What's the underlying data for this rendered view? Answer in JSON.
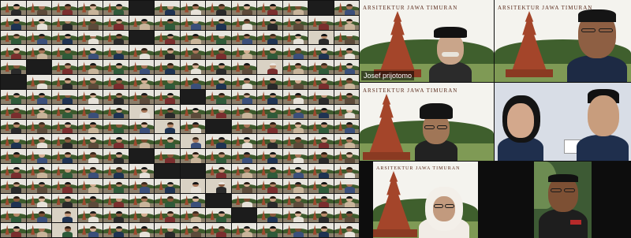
{
  "window": {
    "view_mode": "gallery"
  },
  "gallery": {
    "columns": 14,
    "rows": 16,
    "blank_cells": [
      5,
      12,
      33,
      57,
      70,
      91,
      120,
      145,
      160,
      161,
      190,
      205
    ],
    "room_cells": [
      40,
      66,
      103,
      118,
      133,
      175,
      176,
      198,
      212
    ]
  },
  "speakers": [
    {
      "id": "tile-1",
      "banner": "ARSITEKTUR JAWA TIMURAN",
      "name": "Josef prijotomo",
      "skin": "#c9a58a",
      "shirt": "#2b2b2b",
      "cap": "#111111",
      "accent": "#b52a2a"
    },
    {
      "id": "tile-2",
      "banner": "ARSITEKTUR JAWA TIMURAN",
      "name": "",
      "skin": "#8e5f43",
      "shirt": "#1d2a44",
      "cap": "",
      "accent": "#b52a2a"
    },
    {
      "id": "tile-3",
      "banner": "ARSITEKTUR JAWA TIMURAN",
      "name": "",
      "skin": "#a07657",
      "shirt": "#222222",
      "cap": "#141414",
      "accent": "#b52a2a"
    },
    {
      "id": "tile-4",
      "banner": "",
      "name": "",
      "skin": "#d3a88c",
      "shirt": "#1f2f4d",
      "cap": "",
      "accent": "#b52a2a"
    },
    {
      "id": "tile-5",
      "banner": "ARSITEKTUR JAWA TIMURAN",
      "name": "",
      "skin": "#c29a7e",
      "shirt": "#f1ece6",
      "cap": "",
      "accent": "#b52a2a"
    },
    {
      "id": "tile-6",
      "banner": "",
      "name": "",
      "skin": "#7d5034",
      "shirt": "#1e1e1e",
      "cap": "",
      "accent": "#b52a2a"
    }
  ]
}
